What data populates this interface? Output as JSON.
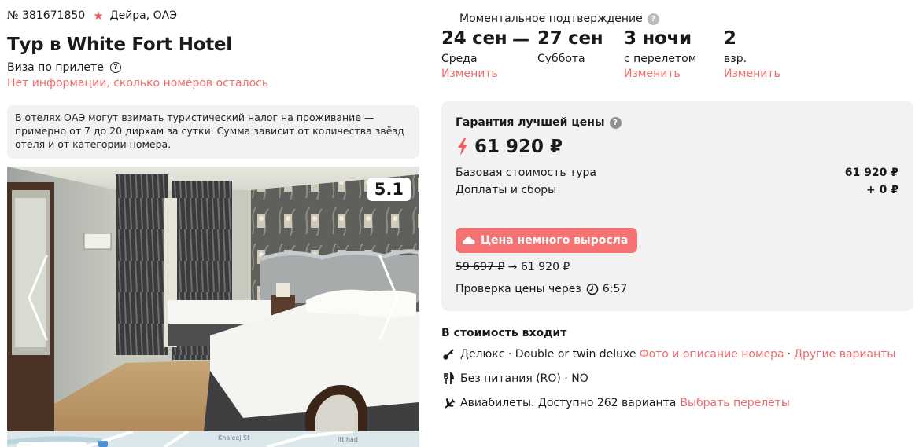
{
  "tour": {
    "number": "№ 381671850",
    "location": "Дейра, ОАЭ",
    "title": "Тур в White Fort Hotel",
    "visa": "Виза по прилете",
    "rooms_info": "Нет информации, сколько номеров осталось",
    "tax_note": "В отелях ОАЭ могут взимать туристический налог на проживание — примерно от 7 до 20 дирхам за сутки. Сумма зависит от количества звёзд отеля и от категории номера."
  },
  "gallery": {
    "rating": "5.1",
    "map_labels": [
      "Khaleej St",
      "Ittihad"
    ]
  },
  "dates": {
    "confirm_label": "Моментальное подтверждение",
    "start_date": "24 сен",
    "start_day": "Среда",
    "separator": "—",
    "end_date": "27 сен",
    "end_day": "Суббота",
    "nights": "3 ночи",
    "nights_note": "с перелетом",
    "guests": "2",
    "guests_note": "взр.",
    "change_label": "Изменить"
  },
  "price": {
    "guarantee": "Гарантия лучшей цены",
    "total": "61 920 ₽",
    "base_label": "Базовая стоимость тура",
    "base_value": "61 920 ₽",
    "fees_label": "Доплаты и сборы",
    "fees_value": "+ 0 ₽",
    "rose_label": "Цена немного выросла",
    "old_price": "59 697 ₽",
    "arrow": "→",
    "new_price": "61 920 ₽",
    "check_label": "Проверка цены через",
    "check_time": "6:57"
  },
  "included": {
    "title": "В стоимость входит",
    "room_text": "Делюкс · Double or twin deluxe",
    "room_link": "Фото и описание номера",
    "sep": "·",
    "room_link2": "Другие варианты",
    "meal": "Без питания (RO) · NO",
    "flights_text": "Авиабилеты. Доступно 262 варианта",
    "flights_link": "Выбрать перелёты"
  },
  "colors": {
    "accent": "#ef6b6b",
    "button": "#f47272",
    "card_bg": "#f2f2f2"
  }
}
